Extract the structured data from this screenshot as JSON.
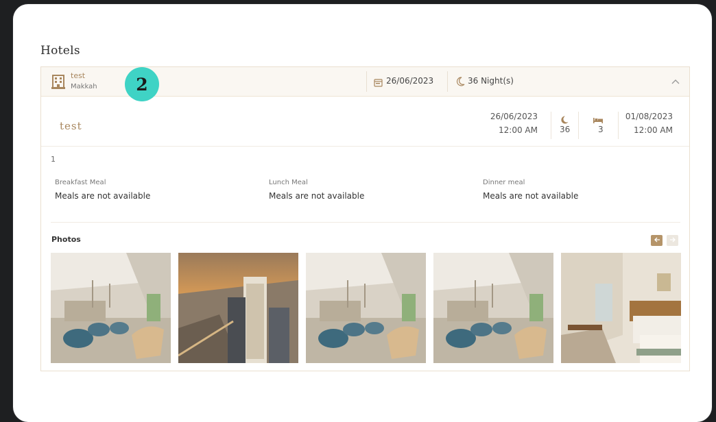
{
  "section": {
    "title": "Hotels"
  },
  "header": {
    "hotel_name": "test",
    "city": "Makkah",
    "step_number": "2",
    "checkin_date": "26/06/2023",
    "nights_label": "36 Night(s)"
  },
  "details": {
    "hotel_logo_text": "test",
    "checkin_date": "26/06/2023",
    "checkin_time": "12:00 AM",
    "nights": "36",
    "rooms": "3",
    "checkout_date": "01/08/2023",
    "checkout_time": "12:00 AM"
  },
  "room": {
    "number": "1"
  },
  "meals": [
    {
      "label": "Breakfast Meal",
      "value": "Meals are not available"
    },
    {
      "label": "Lunch Meal",
      "value": "Meals are not available"
    },
    {
      "label": "Dinner meal",
      "value": "Meals are not available"
    }
  ],
  "photos": {
    "title": "Photos"
  },
  "colors": {
    "accent": "#a8865d",
    "badge": "#3fd3c5",
    "header_bg": "#faf7f2"
  },
  "icons": [
    "building-icon",
    "calendar-icon",
    "moon-icon",
    "chevron-up-icon",
    "bed-icon",
    "arrow-left-icon",
    "arrow-right-icon"
  ]
}
